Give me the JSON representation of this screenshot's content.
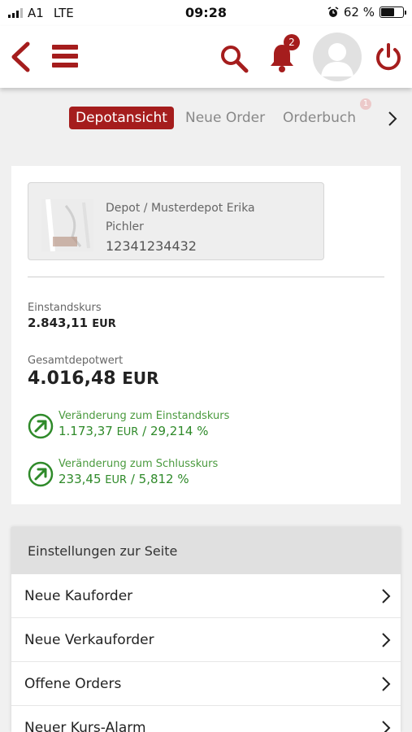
{
  "status_bar": {
    "carrier": "A1",
    "network": "LTE",
    "time": "09:28",
    "battery": "62 %",
    "battery_level": 0.62
  },
  "header": {
    "notification_count": "2"
  },
  "tabs": [
    {
      "label": "Depotansicht",
      "active": true
    },
    {
      "label": "Neue Order",
      "active": false
    },
    {
      "label": "Orderbuch",
      "active": false
    }
  ],
  "tab_badge": "1",
  "depot": {
    "line1": "Depot / Musterdepot Erika",
    "line2": "Pichler",
    "number": "12341234432"
  },
  "einstand": {
    "label": "Einstandskurs",
    "value": "2.843,11",
    "currency": "EUR"
  },
  "gesamt": {
    "label": "Gesamtdepotwert",
    "value": "4.016,48",
    "currency": "EUR"
  },
  "changes": [
    {
      "label": "Veränderung zum Einstandskurs",
      "amount": "1.173,37",
      "currency": "EUR",
      "percent": "/ 29,214 %"
    },
    {
      "label": "Veränderung zum Schlusskurs",
      "amount": "233,45",
      "currency": "EUR",
      "percent": "/ 5,812 %"
    }
  ],
  "settings": {
    "title": "Einstellungen zur Seite",
    "items": [
      "Neue Kauforder",
      "Neue Verkauforder",
      "Offene Orders",
      "Neuer Kurs-Alarm"
    ]
  },
  "colors": {
    "brand": "#a51d1d",
    "positive": "#2f8a2a"
  }
}
